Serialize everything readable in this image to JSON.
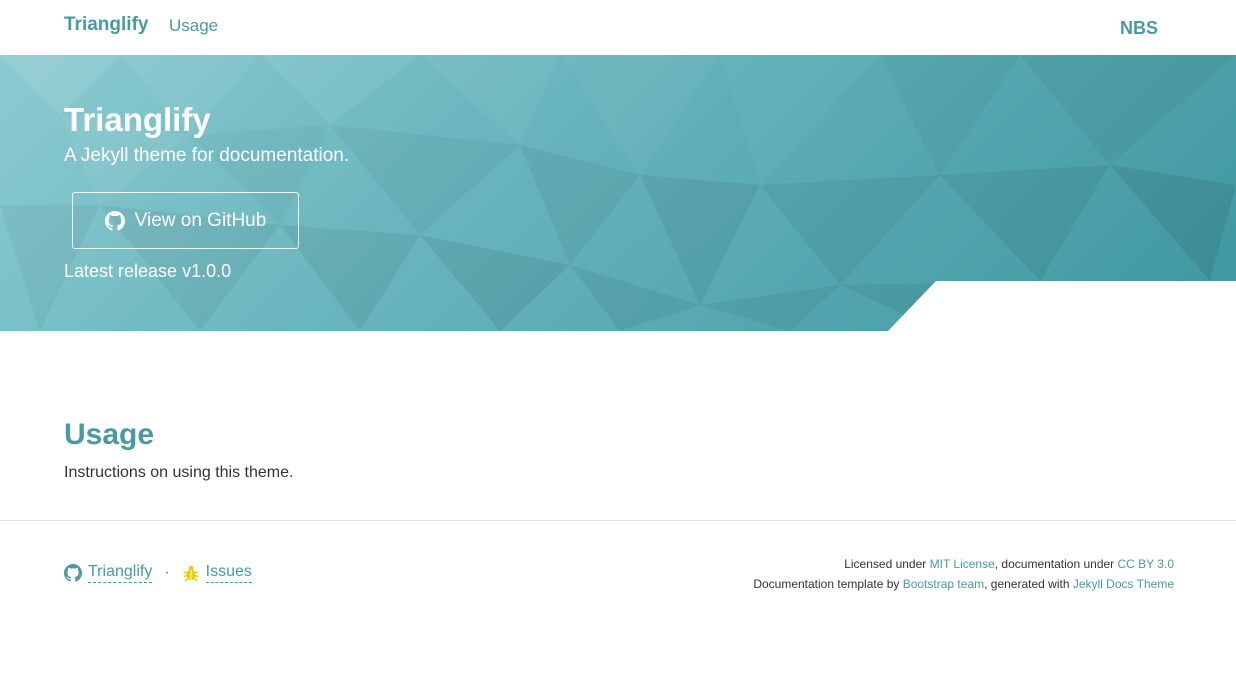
{
  "nav": {
    "brand": "Trianglify",
    "links": [
      "Usage"
    ],
    "logo_text": "NBS"
  },
  "hero": {
    "title": "Trianglify",
    "subtitle": "A Jekyll theme for documentation.",
    "button_label": "View on GitHub",
    "release": "Latest release v1.0.0"
  },
  "main": {
    "title": "Usage",
    "text": "Instructions on using this theme."
  },
  "footer": {
    "left_links": [
      {
        "icon": "github-icon",
        "label": "Trianglify"
      },
      {
        "icon": "bug-icon",
        "label": "Issues"
      }
    ],
    "separator": "·",
    "line1": {
      "prefix": "Licensed under ",
      "link1": "MIT License",
      "middle": ", documentation under ",
      "link2": "CC BY 3.0"
    },
    "line2": {
      "prefix": "Documentation template by ",
      "link1": "Bootstrap team",
      "middle": ", generated with ",
      "link2": "Jekyll Docs Theme"
    }
  },
  "colors": {
    "accent": "#4a9aa3",
    "hero_light": "#8ccad1",
    "hero_dark": "#3f979f",
    "bug_icon": "#f2c811"
  }
}
